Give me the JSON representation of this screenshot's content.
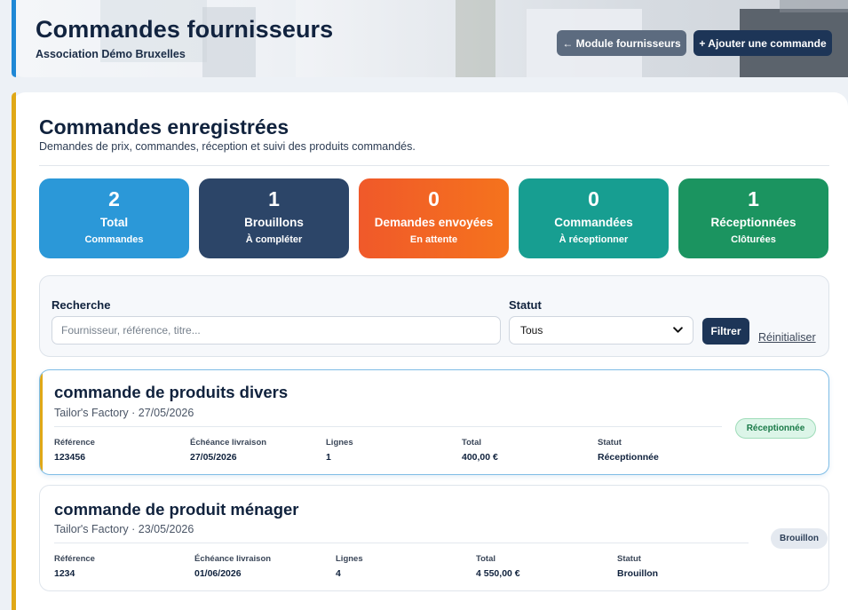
{
  "header": {
    "title": "Commandes fournisseurs",
    "subtitle": "Association Démo Bruxelles",
    "back_button": "← Module fournisseurs",
    "add_button": "+ Ajouter une commande"
  },
  "main": {
    "title": "Commandes enregistrées",
    "subtitle": "Demandes de prix, commandes, réception et suivi des produits commandés."
  },
  "stats": [
    {
      "value": "2",
      "label": "Total",
      "sub": "Commandes",
      "color": "#2b98d8"
    },
    {
      "value": "1",
      "label": "Brouillons",
      "sub": "À compléter",
      "color": "#2c4568"
    },
    {
      "value": "0",
      "label": "Demandes envoyées",
      "sub": "En attente",
      "color": "#f26a22"
    },
    {
      "value": "0",
      "label": "Commandées",
      "sub": "À réceptionner",
      "color": "#179e91"
    },
    {
      "value": "1",
      "label": "Réceptionnées",
      "sub": "Clôturées",
      "color": "#1b9460"
    }
  ],
  "filter": {
    "search_label": "Recherche",
    "search_placeholder": "Fournisseur, référence, titre...",
    "status_label": "Statut",
    "status_selected": "Tous",
    "filter_button": "Filtrer",
    "reset_link": "Réinitialiser"
  },
  "order_field_labels": {
    "reference": "Référence",
    "due": "Échéance livraison",
    "lines": "Lignes",
    "total": "Total",
    "status": "Statut"
  },
  "orders": [
    {
      "title": "commande de produits divers",
      "meta": "Tailor's Factory · 27/05/2026",
      "reference": "123456",
      "due": "27/05/2026",
      "lines": "1",
      "total": "400,00 €",
      "status": "Réceptionnée",
      "badge": "Réceptionnée"
    },
    {
      "title": "commande de produit ménager",
      "meta": "Tailor's Factory · 23/05/2026",
      "reference": "1234",
      "due": "01/06/2026",
      "lines": "4",
      "total": "4 550,00 €",
      "status": "Brouillon",
      "badge": "Brouillon"
    }
  ],
  "colors": {
    "brand_dark": "#1d3557",
    "accent_gold": "#e0a817",
    "accent_blue": "#1f88d6"
  }
}
